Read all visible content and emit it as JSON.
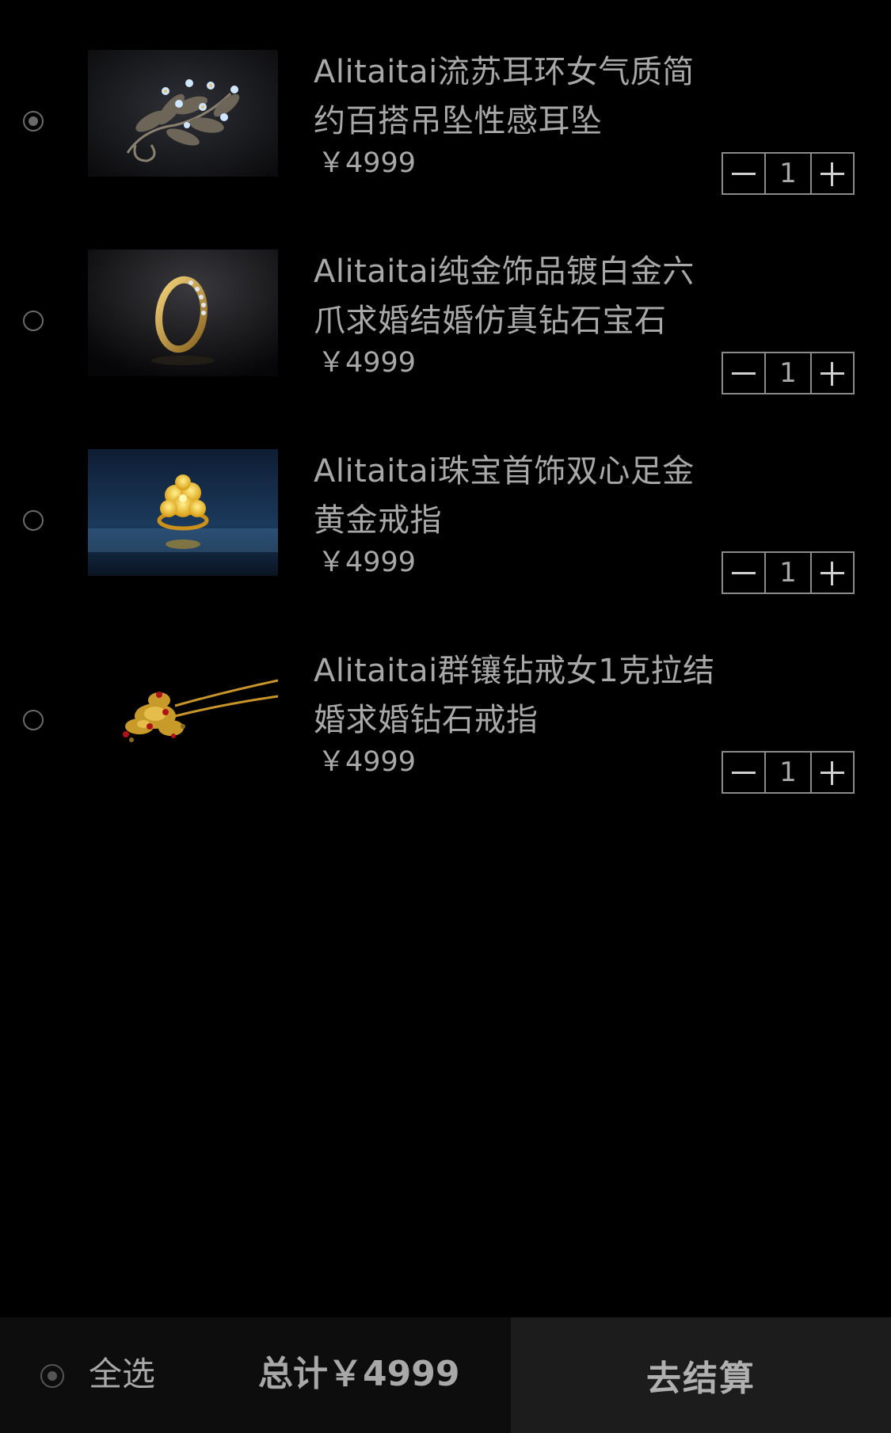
{
  "items": [
    {
      "title_line1": "Alitaitai流苏耳环女气质简",
      "title_line2": "约百搭吊坠性感耳坠",
      "price": "￥4999",
      "quantity": "1",
      "selected": true,
      "image_icon": "brooch-image"
    },
    {
      "title_line1": "Alitaitai纯金饰品镀白金六",
      "title_line2": "爪求婚结婚仿真钻石宝石",
      "price": "￥4999",
      "quantity": "1",
      "selected": false,
      "image_icon": "ring-image"
    },
    {
      "title_line1": "Alitaitai珠宝首饰双心足金",
      "title_line2": "黄金戒指",
      "price": "￥4999",
      "quantity": "1",
      "selected": false,
      "image_icon": "gold-flower-ring-image"
    },
    {
      "title_line1": "Alitaitai群镶钻戒女1克拉结",
      "title_line2": "婚求婚钻石戒指",
      "price": "￥4999",
      "quantity": "1",
      "selected": false,
      "image_icon": "hairpin-image"
    }
  ],
  "footer": {
    "select_all_label": "全选",
    "total_label": "总计￥4999",
    "checkout_label": "去结算",
    "select_all_checked": true
  },
  "colors": {
    "background": "#000000",
    "text": "#a8a8a8",
    "footer_left": "#0d0d0d",
    "footer_right": "#1c1c1c"
  }
}
